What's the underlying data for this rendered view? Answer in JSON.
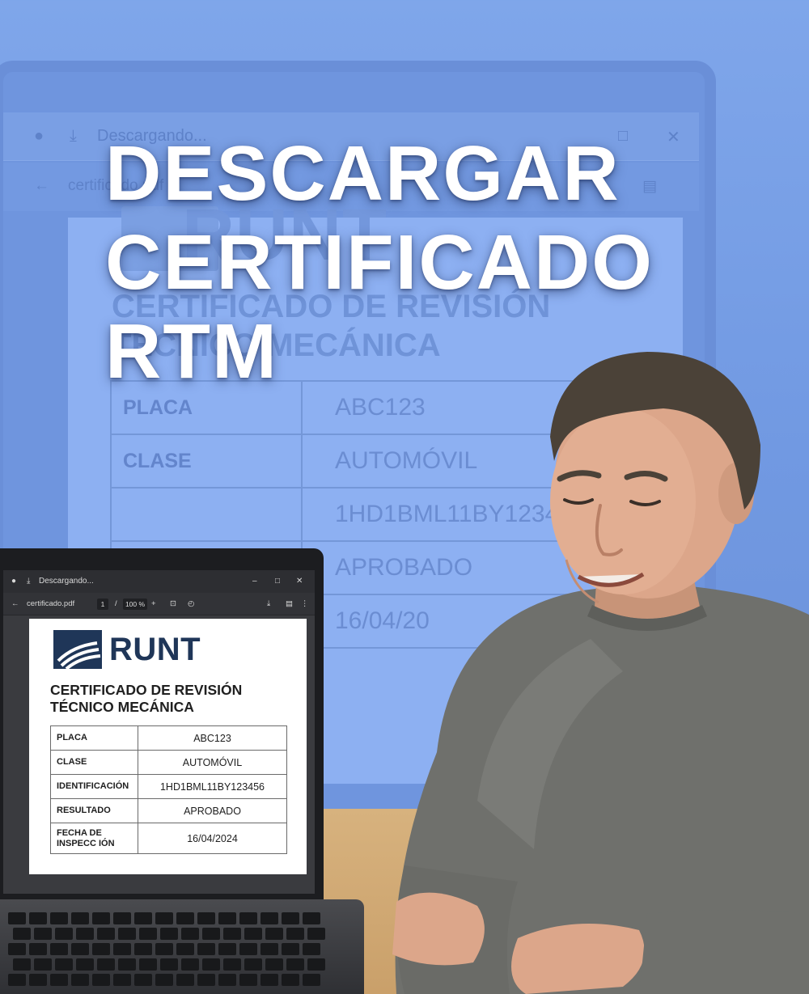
{
  "headline": {
    "line1": "DESCARGAR",
    "line2": "CERTIFICADO",
    "line3": "RTM"
  },
  "background_screen": {
    "window_title": "Descargando...",
    "file_name": "certificado.pdf",
    "logo_text": "RUNT",
    "heading_line1": "CERTIFICADO DE REVISIÓN",
    "heading_line2": "TÉCNICO MECÁNICA",
    "rows": [
      {
        "label": "PLACA",
        "value": "ABC123"
      },
      {
        "label": "CLASE",
        "value": "AUTOMÓVIL"
      },
      {
        "label": "",
        "value": "1HD1BML11BY12345"
      },
      {
        "label": "",
        "value": "APROBADO"
      },
      {
        "label": "",
        "value": "16/04/20"
      }
    ]
  },
  "laptop": {
    "window": {
      "title": "Descargando...",
      "minimize": "–",
      "maximize": "□",
      "close": "✕"
    },
    "toolbar": {
      "back": "←",
      "file_name": "certificado.pdf",
      "page_current": "1",
      "page_separator": "/",
      "zoom": "100 %",
      "zoom_in": "+",
      "more": "⋮"
    },
    "document": {
      "logo_text": "RUNT",
      "heading_line1": "CERTIFICADO DE REVISIÓN",
      "heading_line2": "TÉCNICO MECÁNICA",
      "rows": [
        {
          "label": "PLACA",
          "value": "ABC123"
        },
        {
          "label": "CLASE",
          "value": "AUTOMÓVIL"
        },
        {
          "label": "IDENTIFICACIÓN",
          "value": "1HD1BML11BY123456"
        },
        {
          "label": "RESULTADO",
          "value": "APROBADO"
        },
        {
          "label": "FECHA DE INSPECC IÓN",
          "value": "16/04/2024"
        }
      ]
    }
  },
  "colors": {
    "background_blue": "#7fa6ea",
    "runt_navy": "#1f3658",
    "headline_white": "#ffffff"
  }
}
